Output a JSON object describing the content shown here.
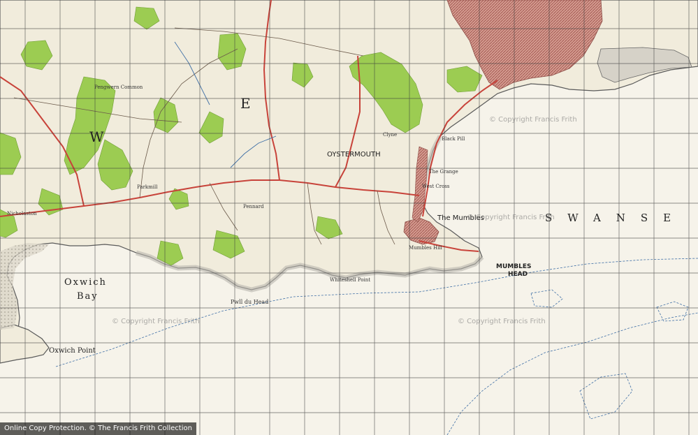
{
  "map": {
    "colors": {
      "land": "#f1ecdc",
      "sea": "#f6f3ea",
      "woodland": "#9ccc52",
      "urban": "#cd8f86",
      "coast_shade": "#a8a8a8",
      "grid": "#3a3a3a",
      "road": "#c8433a"
    },
    "sea_labels": {
      "bay_line1": "Oxwich",
      "bay_line2": "Bay",
      "swansea": "SWANSE"
    },
    "headland_labels": {
      "oxwich_point": "Oxwich Point",
      "mumbles_head_line1": "MUMBLES",
      "mumbles_head_line2": "HEAD",
      "pwll_du_head": "Pwll du Head",
      "whiteshell_point": "Whiteshell Point"
    },
    "place_labels": {
      "oystermouth": "OYSTERMOUTH",
      "the_mumbles": "The Mumbles",
      "pennard": "Pennard",
      "pengwern_common": "Pengwern Common",
      "parkmill": "Parkmill",
      "nicholaston": "Nicholaston",
      "mumbles_hill": "Mumbles Hill",
      "clyne": "Clyne",
      "blackpill": "Black Pill",
      "the_grange": "The Grange",
      "west_cross": "West Cross"
    },
    "watermarks": [
      "© Copyright Francis Frith",
      "© Copyright Francis Frith",
      "© Copyright Francis Frith",
      "© Copyright Francis Frith"
    ],
    "footer": {
      "text": "Online Copy Protection. © The Francis Frith Collection"
    }
  }
}
